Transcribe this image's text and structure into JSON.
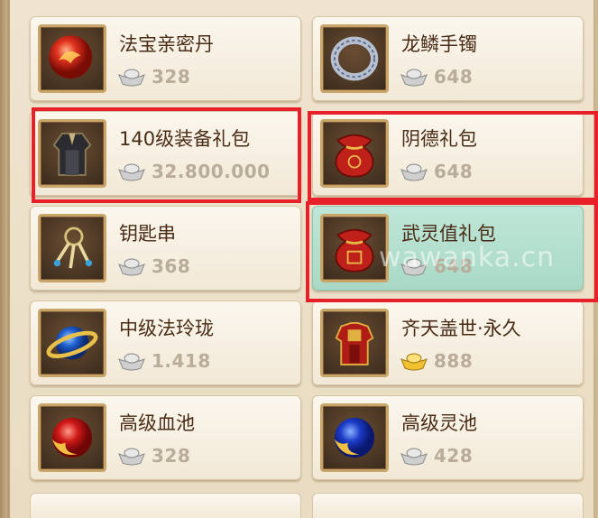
{
  "shop": {
    "items": [
      {
        "name": "法宝亲密丹",
        "price": "328",
        "currency": "silver-ingot",
        "icon": "red-orb-icon"
      },
      {
        "name": "龙鳞手镯",
        "price": "648",
        "currency": "silver-ingot",
        "icon": "bracelet-icon"
      },
      {
        "name": "140级装备礼包",
        "price": "32.800.000",
        "currency": "silver-ingot",
        "icon": "robe-icon",
        "highlighted": true
      },
      {
        "name": "阴德礼包",
        "price": "648",
        "currency": "silver-ingot",
        "icon": "red-pouch-icon",
        "highlighted": true
      },
      {
        "name": "钥匙串",
        "price": "368",
        "currency": "silver-ingot",
        "icon": "key-ring-icon"
      },
      {
        "name": "武灵值礼包",
        "price": "648",
        "currency": "silver-ingot",
        "icon": "red-pouch-icon",
        "highlighted": true,
        "selected": true
      },
      {
        "name": "中级法玲珑",
        "price": "1.418",
        "currency": "silver-ingot",
        "icon": "blue-orb-ring-icon"
      },
      {
        "name": "齐天盖世·永久",
        "price": "888",
        "currency": "gold-ingot",
        "icon": "armor-icon"
      },
      {
        "name": "高级血池",
        "price": "328",
        "currency": "silver-ingot",
        "icon": "red-yinyang-orb-icon"
      },
      {
        "name": "高级灵池",
        "price": "428",
        "currency": "silver-ingot",
        "icon": "blue-yinyang-orb-icon"
      }
    ]
  },
  "watermark": "wawanka.cn",
  "colors": {
    "highlight": "#e8202a",
    "selected_card": "#bfe6d8",
    "card": "#fbf7ee",
    "name_text": "#4a2c16",
    "price_text": "#b9ac99"
  }
}
